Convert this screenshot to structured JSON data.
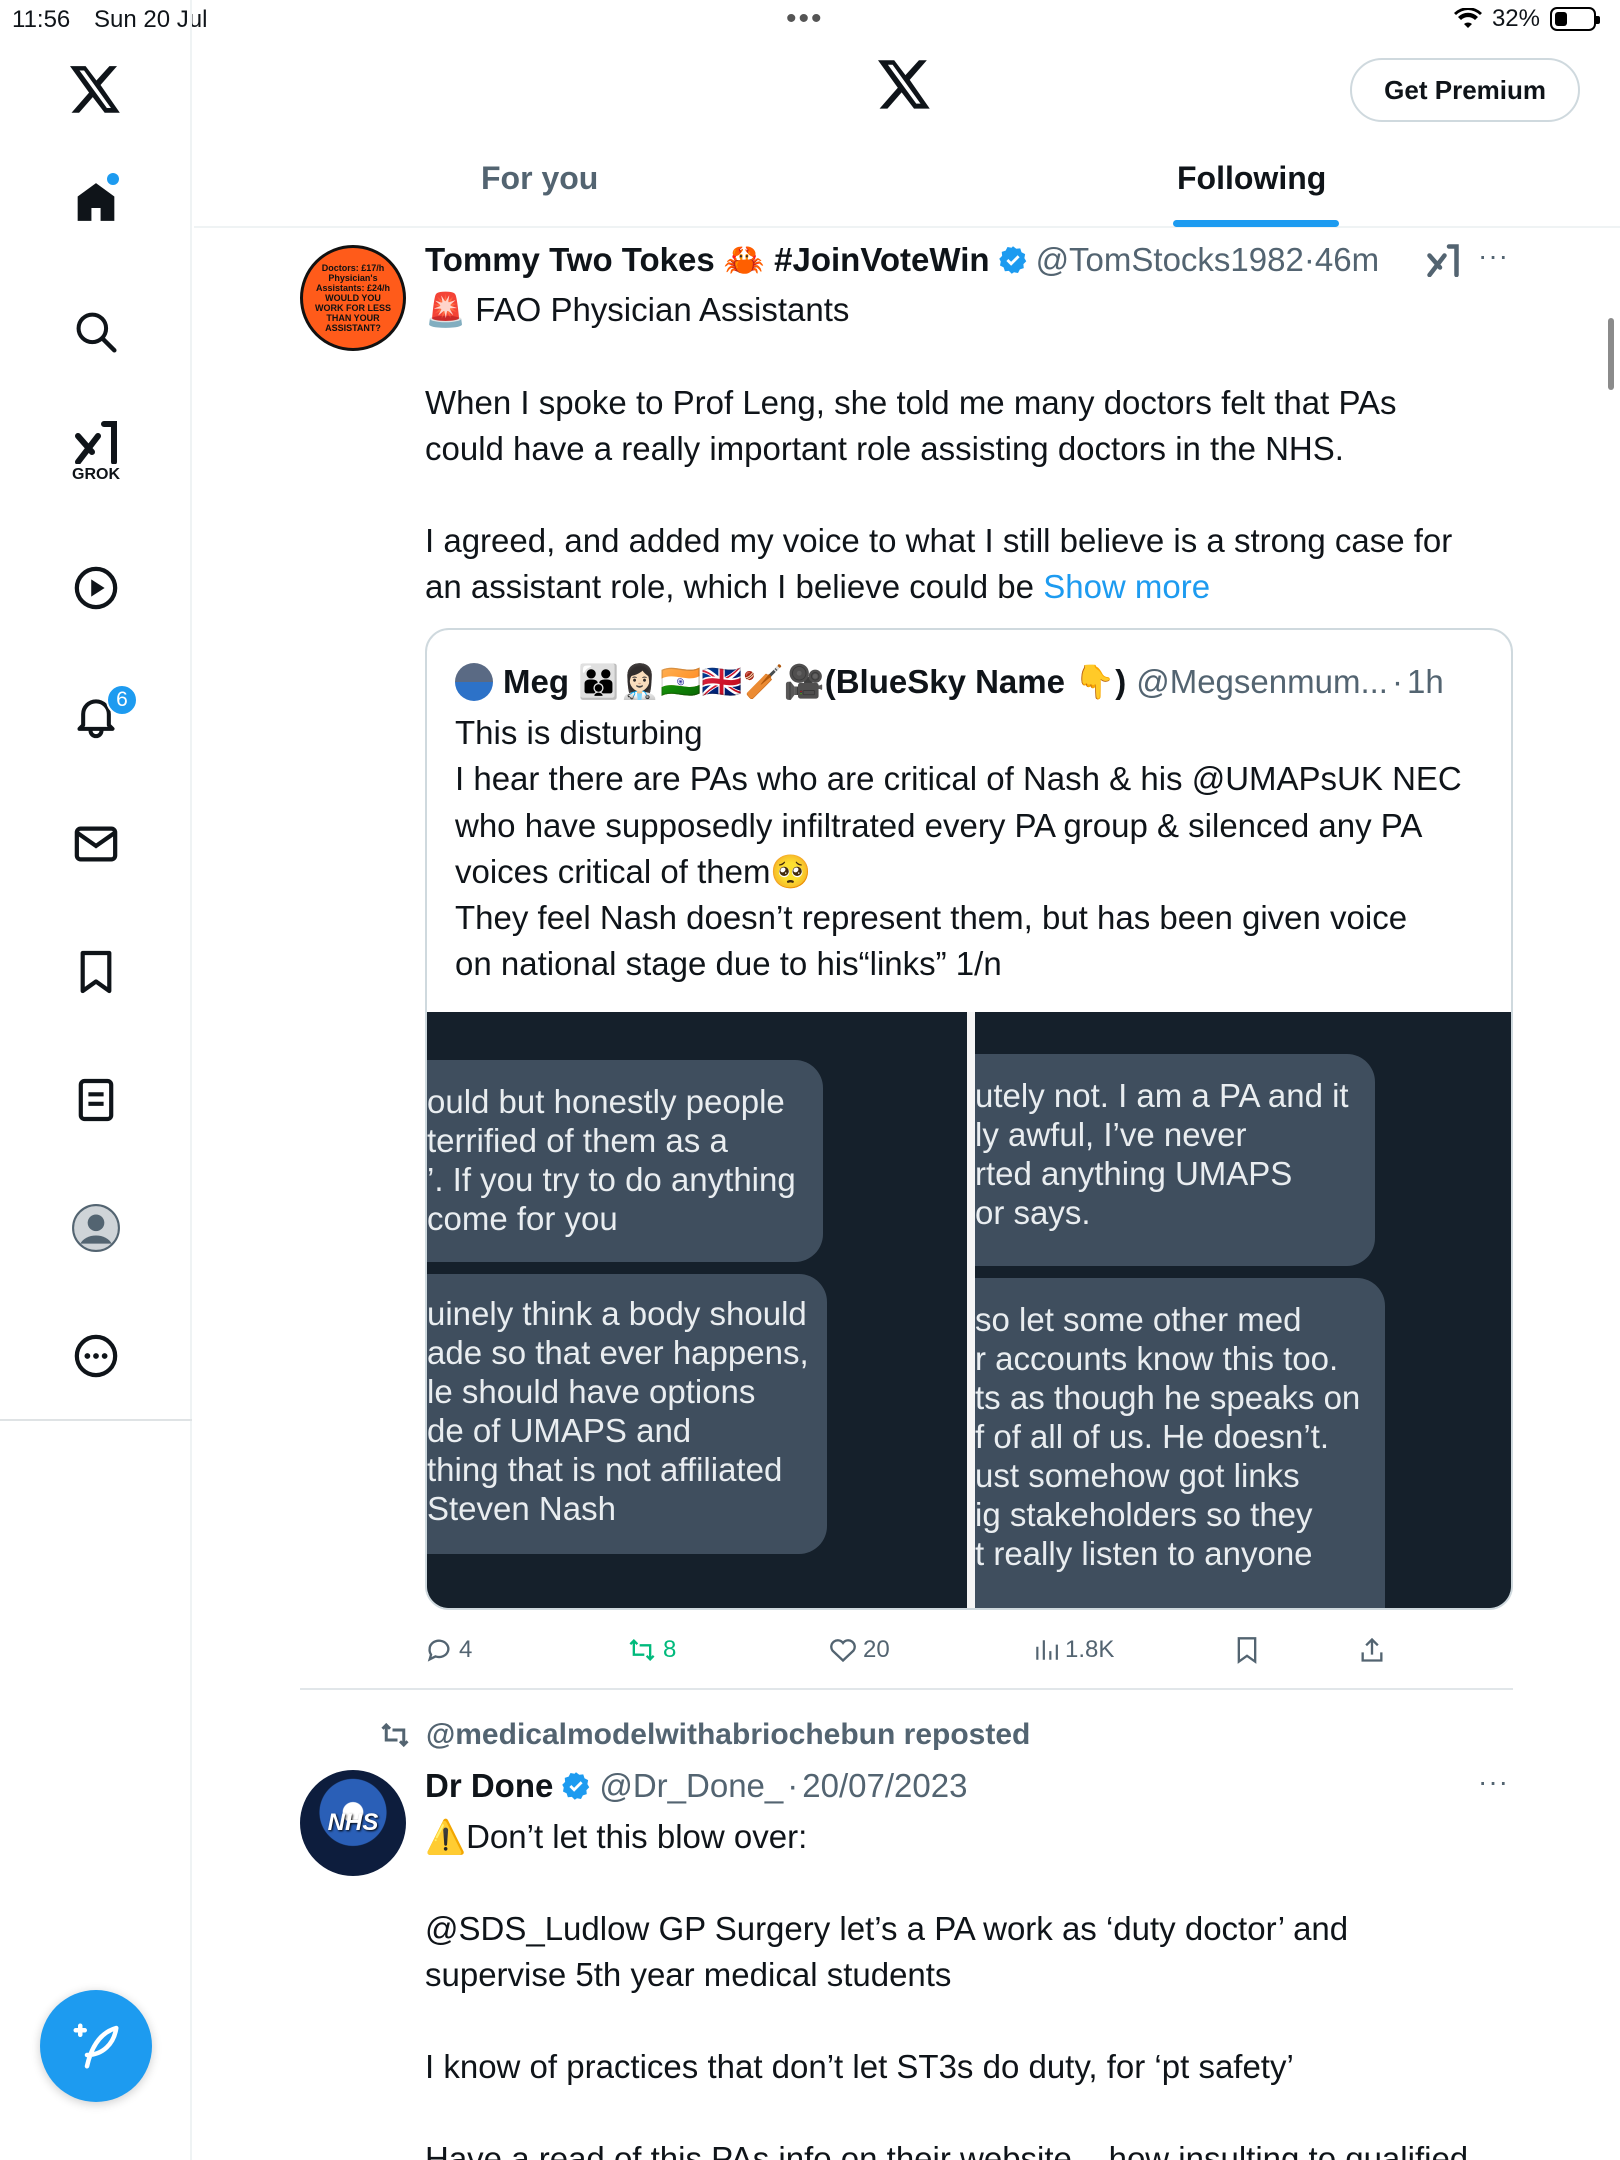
{
  "status_bar": {
    "time": "11:56",
    "date": "Sun 20 Jul",
    "battery": "32%",
    "battery_level": 0.32
  },
  "sidebar": {
    "grok_label": "GROK",
    "notifications_count": "6",
    "items": [
      "x-logo",
      "home",
      "search",
      "grok",
      "video",
      "notifications",
      "messages",
      "bookmarks",
      "lists",
      "profile",
      "more"
    ]
  },
  "header": {
    "premium_label": "Get Premium",
    "tabs": [
      {
        "label": "For you",
        "active": false
      },
      {
        "label": "Following",
        "active": true
      }
    ]
  },
  "tweets": [
    {
      "avatar_text": "Doctors: £17/h Physician's Assistants: £24/h WOULD YOU WORK FOR LESS THAN YOUR ASSISTANT?",
      "name": "Tommy Two Tokes 🦀 #JoinVoteWin",
      "handle": "@TomStocks1982",
      "time": "46m",
      "lines": [
        "🚨 FAO Physician Assistants",
        "When I spoke to Prof Leng, she told me many doctors felt that PAs",
        "could have a really important role assisting doctors in the NHS.",
        "I agreed, and added my voice to what I still believe is a strong case for",
        "an assistant role, which I believe could be"
      ],
      "show_more": "Show more",
      "quote": {
        "name": "Meg 👪👩🏻‍⚕️🇮🇳🇬🇧🏏🎥(BlueSky Name 👇)",
        "handle": "@Megsenmum...",
        "time": "1h",
        "lines": [
          "This is disturbing",
          "I hear there are PAs who are critical of Nash & his @UMAPsUK  NEC",
          "who have supposedly infiltrated every PA group & silenced any PA",
          "voices critical of them🥺",
          "They feel Nash doesn’t represent them, but has been given voice",
          "on national stage due to his“links” 1/n"
        ],
        "left_bubbles": [
          [
            "ould but honestly people",
            "terrified of them as a",
            "’. If you try to do anything",
            "come for you"
          ],
          [
            "uinely think a body should",
            "ade so that ever happens,",
            "le should have options",
            "de of UMAPS and",
            "thing that is not affiliated",
            "Steven Nash"
          ]
        ],
        "right_bubbles": [
          [
            "utely not. I am a PA and it",
            "ly awful, I’ve never",
            "rted anything UMAPS",
            "or says."
          ],
          [
            "so let some other med",
            "r accounts know this too.",
            "ts as though he speaks on",
            "f of all of us. He doesn’t.",
            "ust somehow got links",
            "ig stakeholders so they",
            "t really listen to anyone"
          ]
        ]
      },
      "stats": {
        "replies": "4",
        "reposts": "8",
        "likes": "20",
        "views": "1.8K"
      }
    },
    {
      "repost_by": "@medicalmodelwithabriochebun reposted",
      "avatar_text": "NHS",
      "name": "Dr Done",
      "handle": "@Dr_Done_",
      "time": "20/07/2023",
      "lines": [
        "⚠️Don’t let this blow over:",
        "@SDS_Ludlow GP Surgery let’s a PA work as ‘duty doctor’ and",
        "supervise 5th year medical students",
        "I know of practices that don’t let ST3s do duty, for ‘pt safety’",
        "Have a read of this PAs info on their website – how insulting to qualified"
      ]
    }
  ],
  "colors": {
    "accent": "#1d9bf0",
    "repost_green": "#00ba7c",
    "secondary_text": "#536471"
  }
}
